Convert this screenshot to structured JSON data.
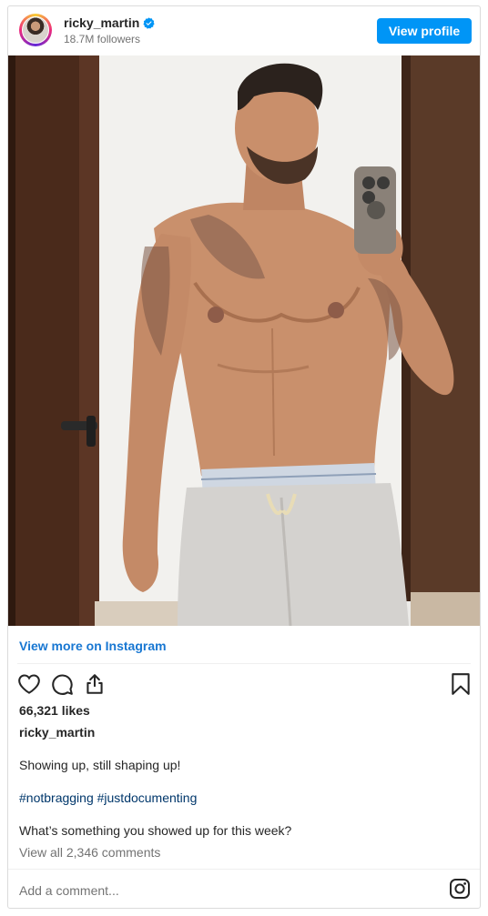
{
  "header": {
    "username": "ricky_martin",
    "followers": "18.7M followers",
    "view_profile_label": "View profile"
  },
  "post": {
    "view_more_label": "View more on Instagram",
    "likes": "66,321 likes",
    "caption_username": "ricky_martin",
    "caption_line1": "Showing up, still shaping up!",
    "hashtags": "#notbragging #justdocumenting",
    "caption_line2": "What’s something you showed up for this week?",
    "view_comments": "View all 2,346 comments"
  },
  "comment_box": {
    "placeholder": "Add a comment..."
  },
  "colors": {
    "accent": "#0095f6",
    "link": "#1877d2",
    "hashtag": "#00376b",
    "verified": "#0095f6"
  },
  "icons": [
    "verified-icon",
    "heart-icon",
    "comment-icon",
    "share-icon",
    "bookmark-icon",
    "instagram-icon"
  ]
}
